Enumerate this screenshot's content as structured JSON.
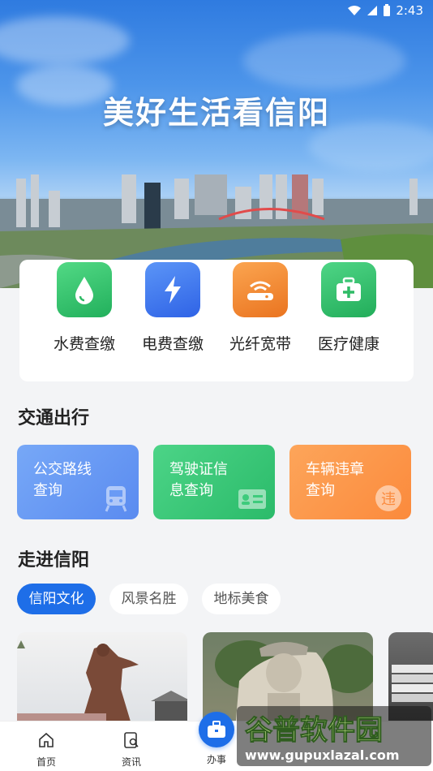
{
  "status": {
    "time": "2:43"
  },
  "hero": {
    "title": "美好生活看信阳"
  },
  "services": [
    {
      "label": "水费查缴",
      "icon": "water-drop-icon",
      "color": "#35c46b"
    },
    {
      "label": "电费查缴",
      "icon": "lightning-icon",
      "color": "#3f7cf0"
    },
    {
      "label": "光纤宽带",
      "icon": "wifi-router-icon",
      "color": "#f0892f"
    },
    {
      "label": "医疗健康",
      "icon": "medical-kit-icon",
      "color": "#32c06a"
    }
  ],
  "transport": {
    "title": "交通出行",
    "cards": [
      {
        "line1": "公交路线",
        "line2": "查询",
        "icon": "bus-icon",
        "color": "#6a9bf5"
      },
      {
        "line1": "驾驶证信",
        "line2": "息查询",
        "icon": "id-card-icon",
        "color": "#3ecb7c"
      },
      {
        "line1": "车辆违章",
        "line2": "查询",
        "icon": "violation-icon",
        "color": "#fb9a4e"
      }
    ]
  },
  "explore": {
    "title": "走进信阳",
    "tabs": [
      "信阳文化",
      "风景名胜",
      "地标美食"
    ],
    "active_tab": 0
  },
  "nav": {
    "items": [
      "首页",
      "资讯",
      "办事"
    ]
  },
  "watermark": {
    "title": "谷普软件园",
    "url": "www.gupuxlazal.com"
  }
}
